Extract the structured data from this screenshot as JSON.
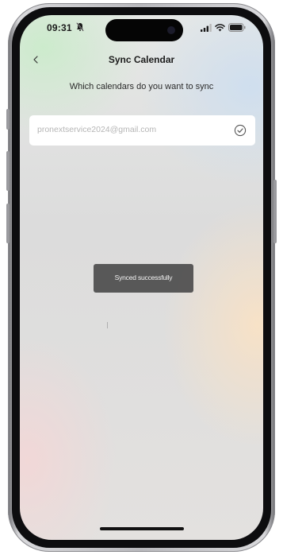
{
  "status_bar": {
    "time": "09:31",
    "dnd_icon": "bell-slash-icon",
    "signal_icon": "cellular-signal-icon",
    "wifi_icon": "wifi-icon",
    "battery_icon": "battery-icon"
  },
  "nav": {
    "back_icon": "chevron-left-icon",
    "title": "Sync Calendar"
  },
  "subtitle": "Which calendars do you want to sync",
  "accounts": [
    {
      "email": "pronextservice2024@gmail.com",
      "selected": true,
      "check_icon": "check-circle-icon"
    }
  ],
  "toast": {
    "message": "Synced successfully"
  },
  "colors": {
    "toast_background": "#464646",
    "account_row_background": "#ffffff",
    "email_text": "#b5b5b5"
  }
}
